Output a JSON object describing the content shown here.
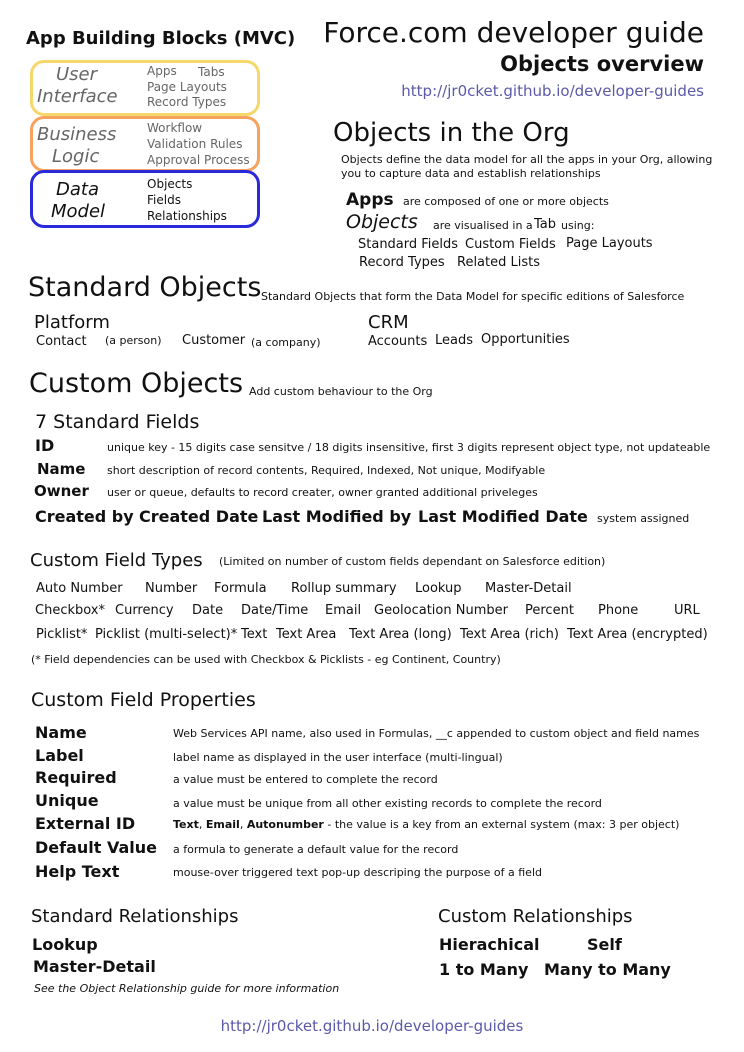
{
  "building_blocks": {
    "title": "App Building Blocks (MVC)",
    "ui": {
      "label_line1": "User",
      "label_line2": "Interface",
      "items": [
        "Apps",
        "Tabs",
        "Page Layouts",
        "Record Types"
      ]
    },
    "business_logic": {
      "label_line1": "Business",
      "label_line2": "Logic",
      "items": [
        "Workflow",
        "Validation Rules",
        "Approval Process"
      ]
    },
    "data_model": {
      "label_line1": "Data",
      "label_line2": "Model",
      "items": [
        "Objects",
        "Fields",
        "Relationships"
      ]
    }
  },
  "header": {
    "title": "Force.com developer guide",
    "subtitle": "Objects overview",
    "url": "http://jr0cket.github.io/developer-guides"
  },
  "objects_in_org": {
    "title": "Objects in the Org",
    "desc_line1": "Objects define the data model for all the apps in your Org, allowing",
    "desc_line2": "you to capture data and establish relationships",
    "apps_word": "Apps",
    "apps_desc": "are composed of one or more objects",
    "objects_word": "Objects",
    "objects_desc": "are visualised in a",
    "tab_word": "Tab",
    "using": "using:",
    "features": [
      "Standard Fields",
      "Custom Fields",
      "Page Layouts",
      "Record Types",
      "Related Lists"
    ]
  },
  "standard_objects": {
    "title": "Standard Objects",
    "desc": "Standard Objects that form the Data Model for specific editions of Salesforce",
    "platform": {
      "title": "Platform",
      "contact": "Contact",
      "contact_note": "(a person)",
      "customer": "Customer",
      "customer_note": "(a company)"
    },
    "crm": {
      "title": "CRM",
      "items": [
        "Accounts",
        "Leads",
        "Opportunities"
      ]
    }
  },
  "custom_objects": {
    "title": "Custom Objects",
    "desc": "Add custom behaviour to the Org",
    "std_fields_title": "7 Standard Fields",
    "fields": [
      {
        "name": "ID",
        "desc": "unique key - 15 digits case sensitve / 18 digits insensitive, first 3 digits represent object type, not updateable"
      },
      {
        "name": "Name",
        "desc": "short description of record contents, Required, Indexed, Not unique, Modifyable"
      },
      {
        "name": "Owner",
        "desc": "user or queue, defaults to record creater, owner granted additional priveleges"
      }
    ],
    "audit_fields": [
      "Created by",
      "Created Date",
      "Last Modified by",
      "Last Modified Date"
    ],
    "audit_note": "system assigned"
  },
  "field_types": {
    "title": "Custom Field Types",
    "note": "(Limited on number of custom fields dependant on Salesforce edition)",
    "row1": [
      "Auto Number",
      "Number",
      "Formula",
      "Rollup summary",
      "Lookup",
      "Master-Detail"
    ],
    "row2": [
      "Checkbox*",
      "Currency",
      "Date",
      "Date/Time",
      "Email",
      "Geolocation Number",
      "Percent",
      "Phone",
      "URL"
    ],
    "row3": [
      "Picklist*",
      "Picklist (multi-select)*",
      "Text",
      "Text Area",
      "Text Area (long)",
      "Text Area (rich)",
      "Text Area (encrypted)"
    ],
    "footnote": "(* Field dependencies can be used with Checkbox & Picklists - eg Continent, Country)"
  },
  "field_properties": {
    "title": "Custom Field Properties",
    "items": [
      {
        "name": "Name",
        "desc": "Web Services API name, also used in Formulas, __c appended to custom object and field names"
      },
      {
        "name": "Label",
        "desc": "label name as displayed in the user interface (multi-lingual)"
      },
      {
        "name": "Required",
        "desc": "a value must be entered to complete the record"
      },
      {
        "name": "Unique",
        "desc": "a value must be unique from all other existing records to complete the record"
      },
      {
        "name": "External ID",
        "desc_b1": "Text",
        "desc_s1": ", ",
        "desc_b2": "Email",
        "desc_s2": ", ",
        "desc_b3": "Autonumber",
        "desc_rest": " - the value is a key  from an external system (max: 3 per object)"
      },
      {
        "name": "Default Value",
        "desc": "a formula to generate a default value for the record"
      },
      {
        "name": "Help Text",
        "desc": "mouse-over triggered text pop-up descriping the purpose of a field"
      }
    ]
  },
  "relationships": {
    "standard_title": "Standard Relationships",
    "standard_items": [
      "Lookup",
      "Master-Detail"
    ],
    "standard_note": "See the Object Relationship guide for more information",
    "custom_title": "Custom Relationships",
    "custom_items": [
      "Hierachical",
      "Self",
      "1 to Many",
      "Many to Many"
    ]
  },
  "footer": {
    "url": "http://jr0cket.github.io/developer-guides"
  }
}
